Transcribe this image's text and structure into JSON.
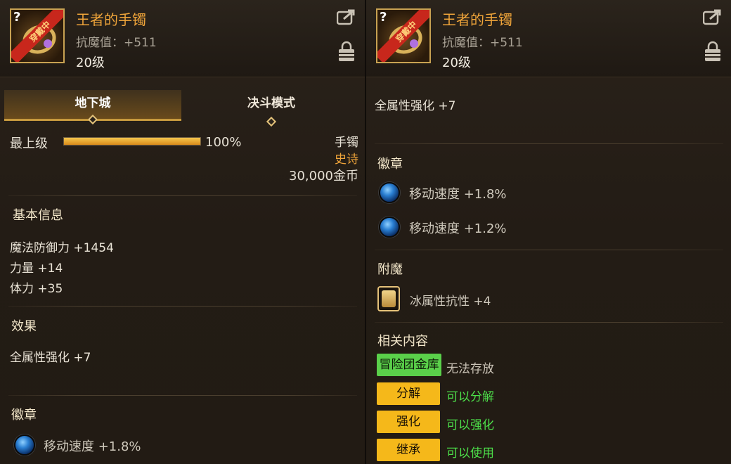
{
  "item": {
    "name": "王者的手镯",
    "resist": "抗魔值：+511",
    "level": "20级",
    "icon_badge": "穿戴中",
    "icon_mark": "?"
  },
  "tabs": [
    {
      "label": "地下城",
      "active": true
    },
    {
      "label": "决斗模式",
      "active": false
    }
  ],
  "rarity": {
    "max_label": "最上级",
    "progress_percent": 100,
    "progress_text": "100%",
    "type": "手镯",
    "grade": "史诗",
    "price": "30,000金币"
  },
  "basic_info": {
    "title": "基本信息",
    "stats": [
      "魔法防御力 +1454",
      "力量 +14",
      "体力 +35"
    ]
  },
  "effects": {
    "title": "效果",
    "lines": [
      "全属性强化 +7"
    ]
  },
  "emblems": {
    "title": "徽章",
    "items": [
      "移动速度 +1.8%",
      "移动速度 +1.2%"
    ]
  },
  "enchant": {
    "title": "附魔",
    "text": "冰属性抗性 +4"
  },
  "related": {
    "title": "相关内容",
    "rows": [
      {
        "tag": "冒险团金库",
        "value": "无法存放",
        "tag_color": "#5ad04a",
        "value_color": "#c9c2b5"
      },
      {
        "tag": "分解",
        "value": "可以分解",
        "tag_color": "#f5b81a",
        "value_color": "#4de04a"
      },
      {
        "tag": "强化",
        "value": "可以强化",
        "tag_color": "#f5b81a",
        "value_color": "#4de04a"
      },
      {
        "tag": "继承",
        "value": "可以使用",
        "tag_color": "#f5b81a",
        "value_color": "#4de04a"
      }
    ]
  },
  "colors": {
    "accent": "#f0a53a",
    "epic": "#f0a53a",
    "positive": "#4de04a"
  }
}
